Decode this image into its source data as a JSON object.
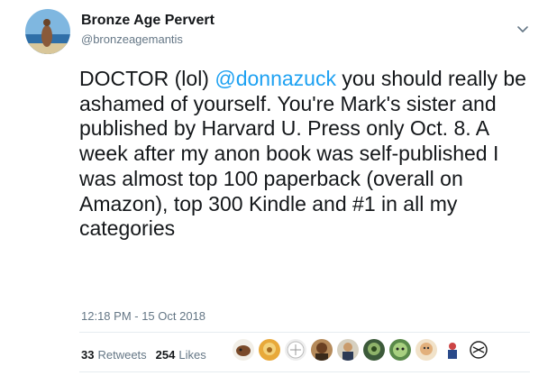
{
  "author": {
    "display_name": "Bronze Age Pervert",
    "handle": "@bronzeagemantis"
  },
  "tweet": {
    "text_before": "DOCTOR (lol) ",
    "mention": "@donnazuck",
    "text_after": " you should really be ashamed of yourself. You're Mark's sister and published by Harvard U. Press only Oct. 8. A week after my anon book was self-published I was almost top 100 paperback (overall on Amazon), top 300 Kindle and #1 in all my categories",
    "timestamp": "12:18 PM - 15 Oct 2018"
  },
  "stats": {
    "retweets_count": "33",
    "retweets_label": "Retweets",
    "likes_count": "254",
    "likes_label": "Likes"
  },
  "colors": {
    "link": "#1da1f2",
    "secondary": "#657786",
    "divider": "#e6ecf0"
  },
  "icons": {
    "more": "chevron-down-icon"
  }
}
